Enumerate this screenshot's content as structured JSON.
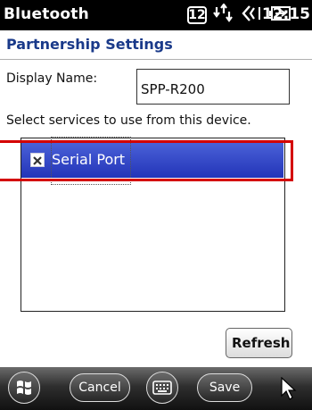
{
  "titlebar": {
    "app_title": "Bluetooth",
    "notification_count": "12",
    "clock": "12:15",
    "icons": [
      "notification-badge-icon",
      "network-sync-icon",
      "volume-icon",
      "battery-charging-icon"
    ]
  },
  "header": {
    "title": "Partnership Settings"
  },
  "form": {
    "display_name_label": "Display Name:",
    "display_name_value": "SPP-R200",
    "services_label": "Select services to use from this device."
  },
  "services": [
    {
      "label": "Serial Port",
      "checked": true,
      "selected": true
    }
  ],
  "buttons": {
    "refresh": "Refresh"
  },
  "softbar": {
    "icons": [
      "windows-start-icon",
      "keyboard-icon",
      "pointer-cursor-icon"
    ],
    "cancel_label": "Cancel",
    "save_label": "Save"
  },
  "colors": {
    "header_text": "#1a3a8a",
    "selection": "#2334b8",
    "annotation": "#d40000"
  }
}
